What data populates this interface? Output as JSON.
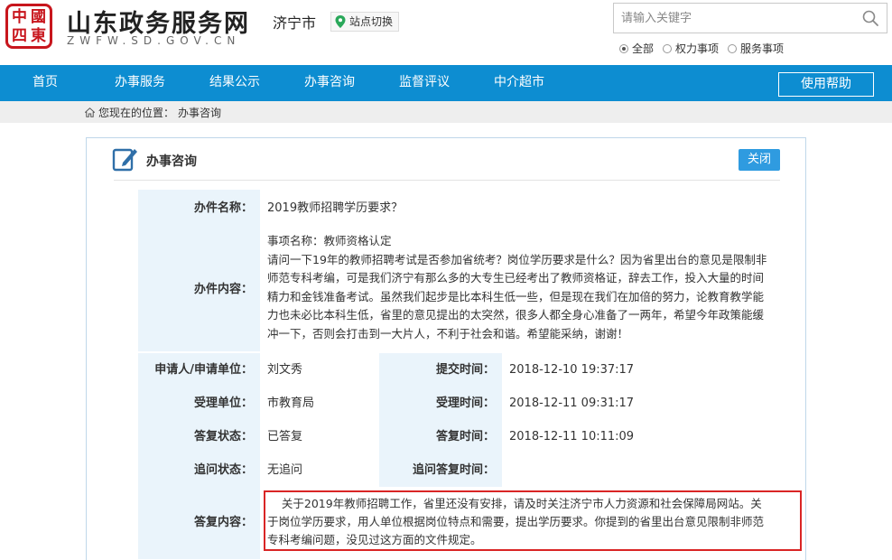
{
  "header": {
    "logo_chars": [
      "中",
      "國",
      "四",
      "東"
    ],
    "site_name": "山东政务服务网",
    "site_domain": "ZWFW.SD.GOV.CN",
    "city": "济宁市",
    "switch_label": "站点切换",
    "search_placeholder": "请输入关键字",
    "scope_options": [
      {
        "label": "全部",
        "selected": true
      },
      {
        "label": "权力事项",
        "selected": false
      },
      {
        "label": "服务事项",
        "selected": false
      }
    ]
  },
  "nav": {
    "items": [
      "首页",
      "办事服务",
      "结果公示",
      "办事咨询",
      "监督评议",
      "中介超市"
    ],
    "help_label": "使用帮助"
  },
  "breadcrumb": {
    "prefix": "您现在的位置：",
    "current": "办事咨询"
  },
  "panel": {
    "title": "办事咨询",
    "close_label": "关闭",
    "case_name_label": "办件名称：",
    "case_name": "2019教师招聘学历要求？",
    "content_label": "办件内容：",
    "content_lines": [
      "事项名称：教师资格认定",
      "请问一下19年的教师招聘考试是否参加省统考？岗位学历要求是什么？因为省里出台的意见是限制非",
      "师范专科考编，可是我们济宁有那么多的大专生已经考出了教师资格证，辞去工作，投入大量的时间",
      "精力和金钱准备考试。虽然我们起步是比本科生低一些，但是现在我们在加倍的努力，论教育教学能",
      "力也未必比本科生低，省里的意见提出的太突然，很多人都全身心准备了一两年，希望今年政策能缓",
      "冲一下，否则会打击到一大片人，不利于社会和谐。希望能采纳，谢谢！"
    ],
    "applicant_label": "申请人/申请单位：",
    "applicant": "刘文秀",
    "submit_time_label": "提交时间：",
    "submit_time": "2018-12-10 19:37:17",
    "accept_unit_label": "受理单位：",
    "accept_unit": "市教育局",
    "accept_time_label": "受理时间：",
    "accept_time": "2018-12-11 09:31:17",
    "reply_status_label": "答复状态：",
    "reply_status": "已答复",
    "reply_time_label": "答复时间：",
    "reply_time": "2018-12-11 10:11:09",
    "followup_status_label": "追问状态：",
    "followup_status": "无追问",
    "followup_reply_time_label": "追问答复时间：",
    "followup_reply_time": "",
    "answer_label": "答复内容：",
    "answer_lines": [
      "    关于2019年教师招聘工作，省里还没有安排，请及时关注济宁市人力资源和社会保障局网站。关",
      "于岗位学历要求，用人单位根据岗位特点和需要，提出学历要求。你提到的省里出台意见限制非师范",
      "专科考编问题，没见过这方面的文件规定。"
    ]
  },
  "colors": {
    "nav_blue": "#0d8dd1",
    "seal_red": "#c8161d",
    "label_bg": "#eaf4fb",
    "close_btn": "#2f9be0",
    "highlight_red": "#d92525"
  }
}
